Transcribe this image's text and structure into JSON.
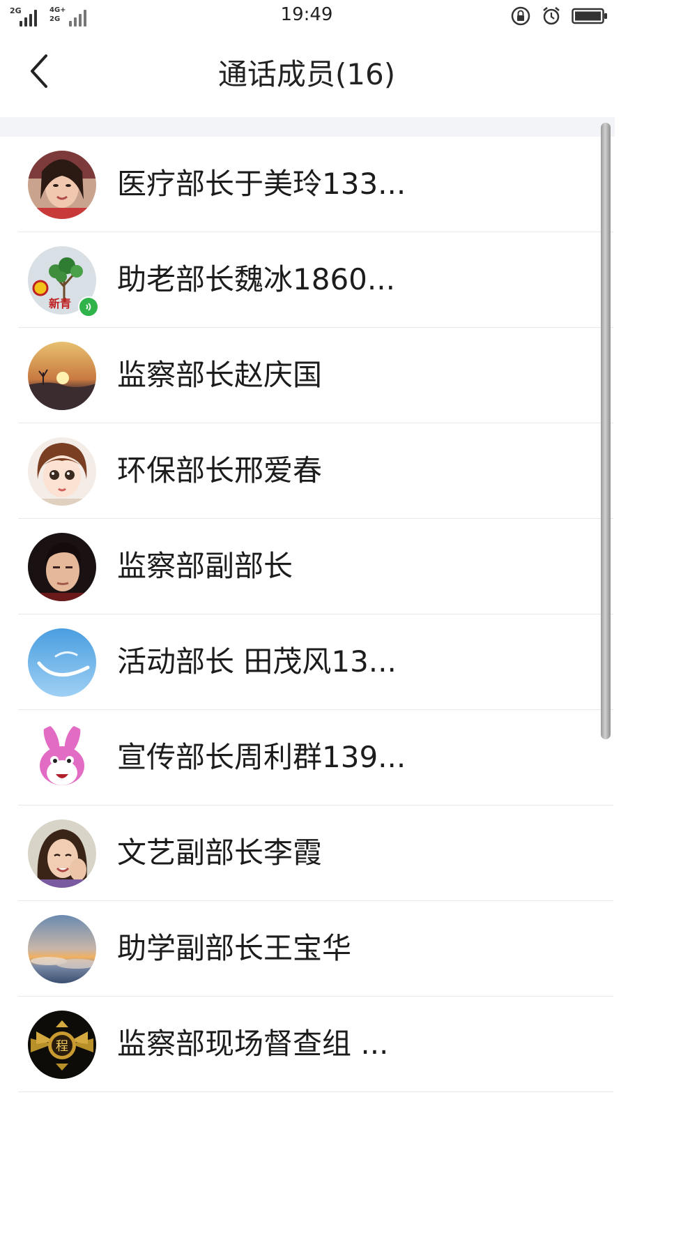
{
  "status_bar": {
    "net_left": "2G",
    "net_right_top": "4G+",
    "net_right_bottom": "2G",
    "time": "19:49",
    "icons": [
      "rotation-lock-icon",
      "alarm-icon",
      "battery-icon"
    ]
  },
  "header": {
    "back_icon": "chevron-left-icon",
    "title": "通话成员(16)"
  },
  "members": [
    {
      "name": "医疗部长于美玲133...",
      "avatar": "photo-woman"
    },
    {
      "name": "助老部长魏冰1860...",
      "avatar": "tree-logo",
      "avatar_text": "新青",
      "badge": "voice-speaking-icon"
    },
    {
      "name": "监察部长赵庆国",
      "avatar": "sunset"
    },
    {
      "name": "环保部长邢爱春",
      "avatar": "cartoon-girl"
    },
    {
      "name": "监察部副部长",
      "avatar": "photo-man"
    },
    {
      "name": "活动部长 田茂风13...",
      "avatar": "blue-sky"
    },
    {
      "name": "宣传部长周利群139...",
      "avatar": "pink-rabbit"
    },
    {
      "name": "文艺副部长李霞",
      "avatar": "photo-woman-smiling"
    },
    {
      "name": "助学副部长王宝华",
      "avatar": "clouds-sunset"
    },
    {
      "name": "监察部现场督查组 ...",
      "avatar": "gold-emblem",
      "avatar_text": "程"
    }
  ],
  "colors": {
    "voice_badge": "#2fb34a",
    "band": "#f3f4f7",
    "divider": "#e9e9ec"
  }
}
